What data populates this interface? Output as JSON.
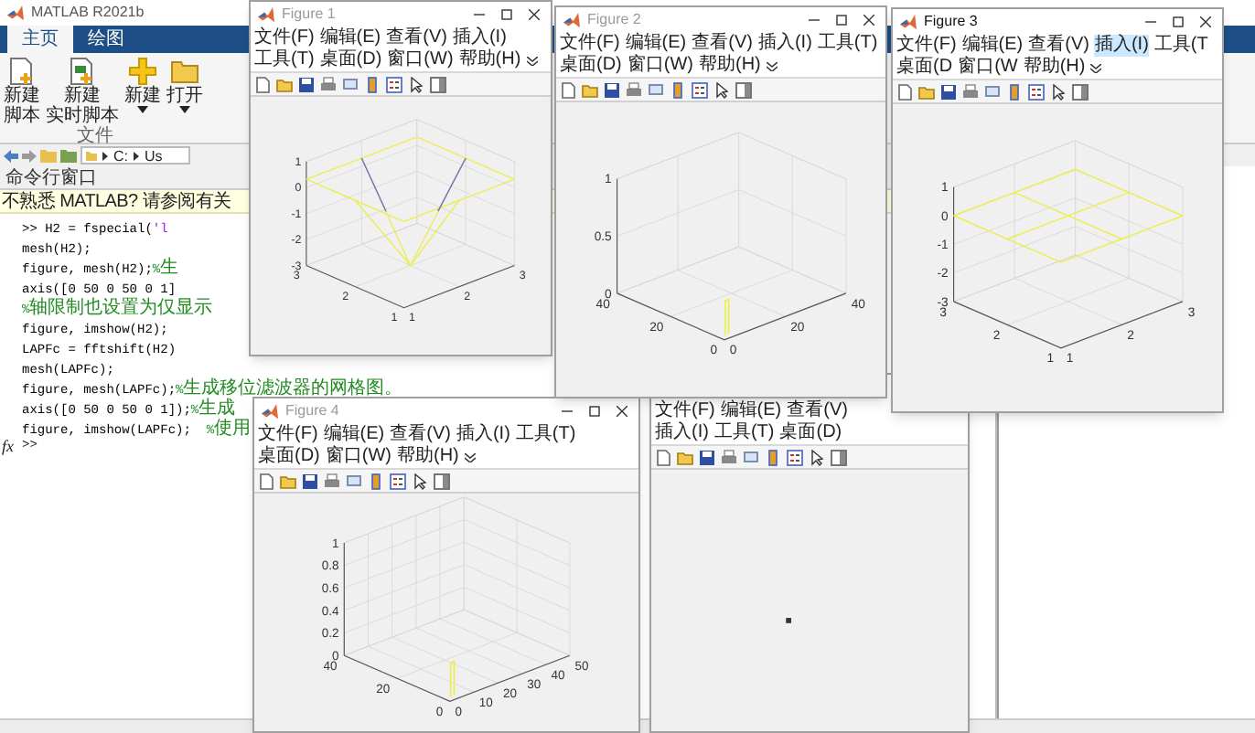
{
  "main_window": {
    "title": "MATLAB R2021b",
    "tabs": [
      {
        "label": "主页",
        "selected": true
      },
      {
        "label": "绘图",
        "selected": false
      }
    ],
    "ribbon": {
      "buttons": [
        {
          "kind": "script",
          "lines": [
            "新建",
            "脚本"
          ],
          "dropdown": false
        },
        {
          "kind": "live-script",
          "lines": [
            "新建",
            "实时脚本"
          ],
          "dropdown": false
        },
        {
          "kind": "new",
          "lines": [
            "新建"
          ],
          "dropdown": true
        },
        {
          "kind": "open",
          "lines": [
            "打开"
          ],
          "dropdown": true
        }
      ],
      "group_label": "文件"
    },
    "address_bar": {
      "path": [
        "C:",
        "Us"
      ]
    },
    "command_window": {
      "title": "命令行窗口",
      "notice": "不熟悉 MATLAB? 请参阅有关",
      "lines": [
        ">> H2 = fspecial('l",
        "mesh(H2);",
        "figure, mesh(H2);%生",
        "axis([0 50 0 50 0 1]",
        "%轴限制也设置为仅显示",
        "figure, imshow(H2);",
        "LAPFc = fftshift(H2)",
        "mesh(LAPFc);",
        "figure, mesh(LAPFc);%生成移位滤波器的网格图。",
        "axis([0 50 0 50 0 1]);%生成",
        "figure, imshow(LAPFc);  %使用"
      ],
      "prompt": {
        "icon": "fx",
        "text": ">>"
      }
    }
  },
  "figures": [
    {
      "title": "Figure 1",
      "active": false,
      "window_buttons": true,
      "menu": [
        {
          "label": "文件(F)"
        },
        {
          "label": "编辑(E)"
        },
        {
          "label": "查看(V)"
        },
        {
          "label": "插入(I)"
        },
        {
          "label": "工具(T)"
        },
        {
          "label": "桌面(D)"
        },
        {
          "label": "窗口(W)"
        },
        {
          "label": "帮助(H)"
        }
      ],
      "more_menu": true,
      "plot": {
        "kind": "dip",
        "z_ticks": [
          "1",
          "0",
          "-1",
          "-2",
          "-3"
        ],
        "y_ticks": [
          "1",
          "2",
          "3"
        ],
        "x_ticks": [
          "1",
          "2",
          "3"
        ]
      }
    },
    {
      "title": "Figure 2",
      "active": false,
      "window_buttons": true,
      "menu": [
        {
          "label": "文件(F)"
        },
        {
          "label": "编辑(E)"
        },
        {
          "label": "查看(V)"
        },
        {
          "label": "插入(I)"
        },
        {
          "label": "工具(T)"
        },
        {
          "label": "桌面(D)"
        },
        {
          "label": "窗口(W)"
        },
        {
          "label": "帮助(H)"
        }
      ],
      "more_menu": true,
      "plot": {
        "kind": "spike",
        "z_ticks": [
          "1",
          "0.5",
          "0"
        ],
        "y_ticks": [
          "0",
          "20",
          "40"
        ],
        "x_ticks": [
          "0",
          "20",
          "40"
        ]
      }
    },
    {
      "title": "Figure 3",
      "active": true,
      "window_buttons": true,
      "menu": [
        {
          "label": "文件(F)",
          "highlighted": false
        },
        {
          "label": "编辑(E)",
          "highlighted": false
        },
        {
          "label": "查看(V)",
          "highlighted": false
        },
        {
          "label": "插入(I)",
          "highlighted": true
        },
        {
          "label": "工具(T",
          "highlighted": false
        },
        {
          "label": "桌面(D",
          "highlighted": false
        },
        {
          "label": "窗口(W",
          "highlighted": false
        },
        {
          "label": "帮助(H)",
          "highlighted": false
        }
      ],
      "more_menu": true,
      "plot": {
        "kind": "flat",
        "z_ticks": [
          "1",
          "0",
          "-1",
          "-2",
          "-3"
        ],
        "y_ticks": [
          "1",
          "2",
          "3"
        ],
        "x_ticks": [
          "1",
          "2",
          "3"
        ]
      }
    },
    {
      "title": "Figure 4",
      "active": false,
      "window_buttons": true,
      "menu": [
        {
          "label": "文件(F)"
        },
        {
          "label": "编辑(E)"
        },
        {
          "label": "查看(V)"
        },
        {
          "label": "插入(I)"
        },
        {
          "label": "工具(T)"
        },
        {
          "label": "桌面(D)"
        },
        {
          "label": "窗口(W)"
        },
        {
          "label": "帮助(H)"
        }
      ],
      "more_menu": true,
      "plot": {
        "kind": "spike",
        "z_ticks": [
          "1",
          "0.8",
          "0.6",
          "0.4",
          "0.2",
          "0"
        ],
        "y_ticks": [
          "0",
          "20",
          "40"
        ],
        "x_ticks": [
          "0",
          "10",
          "20",
          "30",
          "40",
          "50"
        ]
      }
    },
    {
      "menu": [
        {
          "label": "文件(F)"
        },
        {
          "label": "编辑(E)"
        },
        {
          "label": "查看(V)"
        },
        {
          "label": "插入(I)"
        },
        {
          "label": "工具(T)"
        },
        {
          "label": "桌面(D)"
        }
      ],
      "plot": {
        "kind": "image"
      }
    }
  ]
}
